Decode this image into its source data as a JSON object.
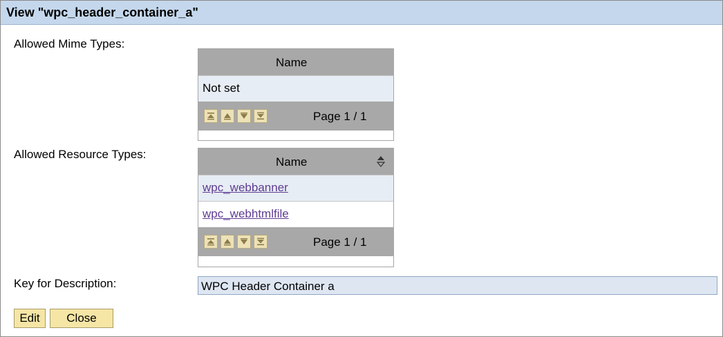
{
  "window": {
    "title": "View \"wpc_header_container_a\""
  },
  "mime_types": {
    "label": "Allowed Mime Types:",
    "column": "Name",
    "rows": [
      "Not set"
    ],
    "pager_text": "Page 1 / 1"
  },
  "resource_types": {
    "label": "Allowed Resource Types:",
    "column": "Name",
    "rows": [
      "wpc_webbanner",
      "wpc_webhtmlfile"
    ],
    "pager_text": "Page 1 / 1"
  },
  "description": {
    "label": "Key for Description:",
    "value": "WPC Header Container a"
  },
  "buttons": {
    "edit": "Edit",
    "close": "Close"
  },
  "colors": {
    "title_bar": "#c4d7ec",
    "table_header": "#a8a8a8",
    "button": "#f5e6a6",
    "link": "#5e3c92"
  }
}
